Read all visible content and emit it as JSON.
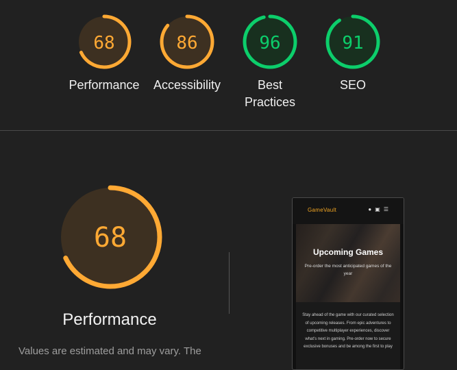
{
  "colors": {
    "orange": "#ffa934",
    "orange_track": "#3d3021",
    "green": "#0cce6b",
    "green_track": "#18301f"
  },
  "categories": [
    {
      "name": "Performance",
      "score": "68",
      "value": 68,
      "status": "average"
    },
    {
      "name": "Accessibility",
      "score": "86",
      "value": 86,
      "status": "average"
    },
    {
      "name_lines": [
        "Best",
        "Practices"
      ],
      "score": "96",
      "value": 96,
      "status": "pass"
    },
    {
      "name": "SEO",
      "score": "91",
      "value": 91,
      "status": "pass"
    }
  ],
  "detail": {
    "score": "68",
    "value": 68,
    "title": "Performance",
    "note": "Values are estimated and may vary. The"
  },
  "screenshot": {
    "brand": "GameVault",
    "icons": [
      "user-icon",
      "cart-icon",
      "menu-icon"
    ],
    "hero_title": "Upcoming Games",
    "hero_subtitle": "Pre-order the most anticipated games of the year",
    "body_text": "Stay ahead of the game with our curated selection of upcoming releases. From epic adventures to competitive multiplayer experiences, discover what's next in gaming. Pre-order now to secure exclusive bonuses and be among the first to play"
  }
}
